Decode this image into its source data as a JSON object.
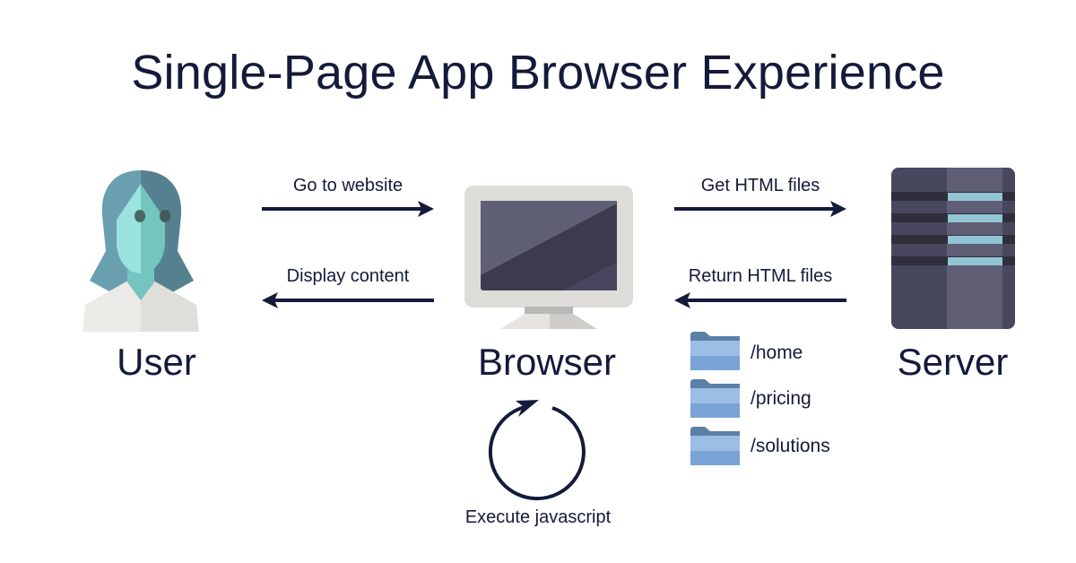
{
  "title": "Single-Page App Browser Experience",
  "nodes": {
    "user": {
      "label": "User",
      "icon": "user-icon"
    },
    "browser": {
      "label": "Browser",
      "icon": "monitor-icon"
    },
    "server": {
      "label": "Server",
      "icon": "server-icon"
    }
  },
  "arrows": {
    "go_to_website": "Go to website",
    "display_content": "Display content",
    "get_html_files": "Get HTML files",
    "return_html_files": "Return HTML files"
  },
  "routes": [
    "/home",
    "/pricing",
    "/solutions"
  ],
  "loop": {
    "label": "Execute javascript",
    "icon": "refresh-loop-icon"
  },
  "colors": {
    "ink": "#141a3a",
    "hair_light": "#6a9fb0",
    "hair_dark": "#55808f",
    "face_light": "#9ae3de",
    "face_dark": "#74c4bf",
    "monitor_frame": "#dedcd8",
    "screen_light": "#5f5f75",
    "screen_dark": "#3c3b4d",
    "server_body": "#47475e",
    "server_mid": "#5f5e75",
    "server_led": "#92c5d4",
    "folder_back": "#5b7fa6",
    "folder_front": "#8db3e2"
  }
}
